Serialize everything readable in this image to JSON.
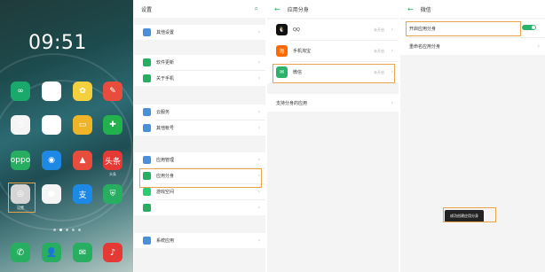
{
  "home": {
    "time": "09:51",
    "side_lines": [
      "",
      ""
    ],
    "apps_row1": [
      {
        "label": "",
        "icon": "infinity-icon",
        "color": "#1aa86b",
        "glyph": "∞"
      },
      {
        "label": "",
        "icon": "calculator-icon",
        "color": "#ffffff",
        "glyph": "÷"
      },
      {
        "label": "",
        "icon": "gallery-icon",
        "color": "#f4d03f",
        "glyph": "✿"
      },
      {
        "label": "",
        "icon": "pen-icon",
        "color": "#e74c3c",
        "glyph": "✎"
      }
    ],
    "apps_row2": [
      {
        "label": "",
        "icon": "clock-icon",
        "color": "#f5f5f5",
        "glyph": "◷"
      },
      {
        "label": "",
        "icon": "calendar-icon",
        "color": "#ffffff",
        "glyph": "14"
      },
      {
        "label": "",
        "icon": "folder-icon",
        "color": "#f0b429",
        "glyph": "▭"
      },
      {
        "label": "",
        "icon": "cart-icon",
        "color": "#22b14c",
        "glyph": "✚"
      }
    ],
    "apps_row3": [
      {
        "label": "",
        "icon": "oppo-icon",
        "color": "#27ae60",
        "glyph": "oppo"
      },
      {
        "label": "",
        "icon": "chat-bubble-icon",
        "color": "#1e88e5",
        "glyph": "◉"
      },
      {
        "label": "",
        "icon": "gradient-icon",
        "color": "#e74c3c",
        "glyph": "▲"
      },
      {
        "label": "头条",
        "icon": "toutiao-icon",
        "color": "#e53935",
        "glyph": "头条"
      }
    ],
    "apps_row4": [
      {
        "label": "设置",
        "icon": "settings-icon",
        "color": "#d6d6d6",
        "glyph": "◎"
      },
      {
        "label": "",
        "icon": "camera-icon",
        "color": "#f5f5f5",
        "glyph": "●"
      },
      {
        "label": "",
        "icon": "alipay-icon",
        "color": "#1e88e5",
        "glyph": "支"
      },
      {
        "label": "",
        "icon": "shield-icon",
        "color": "#27ae60",
        "glyph": "⛨"
      }
    ],
    "dock": [
      {
        "icon": "phone-icon",
        "color": "#27ae60",
        "glyph": "✆"
      },
      {
        "icon": "contacts-icon",
        "color": "#27ae60",
        "glyph": "👤"
      },
      {
        "icon": "message-icon",
        "color": "#27ae60",
        "glyph": "✉"
      },
      {
        "icon": "music-icon",
        "color": "#e53935",
        "glyph": "♪"
      }
    ]
  },
  "settings": {
    "title": "设置",
    "groups": [
      [
        {
          "label": "其他设置",
          "icon_color": "#4a90d9"
        }
      ],
      [
        {
          "label": "软件更新",
          "icon_color": "#27ae60"
        },
        {
          "label": "关于手机",
          "icon_color": "#27ae60"
        }
      ],
      [
        {
          "label": "云服务",
          "icon_color": "#4a90d9"
        },
        {
          "label": "其他帐号",
          "icon_color": "#4a90d9"
        }
      ],
      [
        {
          "label": "应用管理",
          "icon_color": "#4a90d9"
        },
        {
          "label": "应用分身",
          "icon_color": "#27ae60"
        },
        {
          "label": "游戏空间",
          "icon_color": "#2ecc71"
        },
        {
          "label": "",
          "icon_color": "#27ae60"
        }
      ],
      [
        {
          "label": "系统应用",
          "icon_color": "#4a90d9"
        }
      ]
    ]
  },
  "clone_list": {
    "title": "应用分身",
    "apps": [
      {
        "label": "QQ",
        "status": "未开启",
        "icon_color": "#111111",
        "glyph": "🐧"
      },
      {
        "label": "手机淘宝",
        "status": "未开启",
        "icon_color": "#ff6a00",
        "glyph": "淘"
      },
      {
        "label": "微信",
        "status": "未开启",
        "icon_color": "#2bb36b",
        "glyph": "✉"
      }
    ],
    "supported": "支持分身的应用",
    "notes": [
      "",
      "",
      "",
      "",
      "",
      ""
    ]
  },
  "wechat": {
    "title": "微信",
    "toggle_label": "开启应用分身",
    "rename_label": "重命名应用分身",
    "toast": "成功创建应用分身"
  },
  "accent": "#2bb36b",
  "highlight": "#e8a44a"
}
